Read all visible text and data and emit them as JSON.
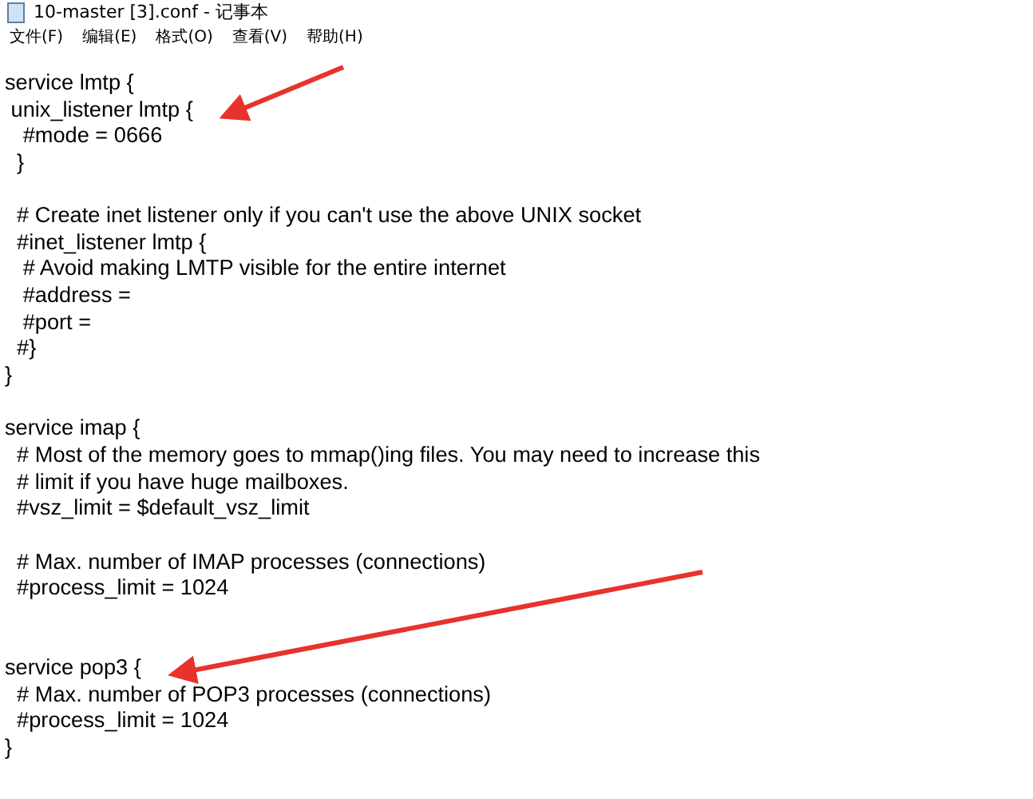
{
  "window": {
    "title": "10-master [3].conf - 记事本"
  },
  "menu": [
    "文件(F)",
    "编辑(E)",
    "格式(O)",
    "查看(V)",
    "帮助(H)"
  ],
  "lines": [
    {
      "text": "service lmtp {"
    },
    {
      "text": " unix_listener lmtp {"
    },
    {
      "text": "   #mode = 0666"
    },
    {
      "text": "  }"
    },
    {
      "text": "  # Create inet listener only if you can't use the above UNIX socket",
      "kind": "spaced"
    },
    {
      "text": "  #inet_listener lmtp {"
    },
    {
      "text": "   # Avoid making LMTP visible for the entire internet"
    },
    {
      "text": "   #address ="
    },
    {
      "text": "   #port ="
    },
    {
      "text": "  #}"
    },
    {
      "text": "}"
    },
    {
      "text": "service imap {",
      "kind": "spaced"
    },
    {
      "text": "  # Most of the memory goes to mmap()ing files. You may need to increase this"
    },
    {
      "text": "  # limit if you have huge mailboxes."
    },
    {
      "text": "  #vsz_limit = $default_vsz_limit"
    },
    {
      "text": "  # Max. number of IMAP processes (connections)",
      "kind": "spaced"
    },
    {
      "text": "  #process_limit = 1024"
    },
    {
      "text": "service pop3 {",
      "kind": "widespaced"
    },
    {
      "text": "  # Max. number of POP3 processes (connections)"
    },
    {
      "text": "  #process_limit = 1024"
    },
    {
      "text": "}"
    }
  ]
}
